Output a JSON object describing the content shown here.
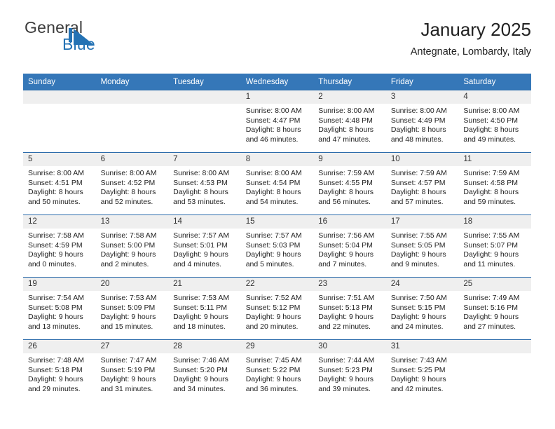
{
  "brand": {
    "name_part1": "General",
    "name_part2": "Blue",
    "mark": "triangle-flag-icon",
    "accent_color": "#2472b4"
  },
  "header": {
    "title": "January 2025",
    "location": "Antegnate, Lombardy, Italy"
  },
  "theme": {
    "header_bg": "#3577b8",
    "daynum_bg": "#efefef",
    "row_divider": "#2c6cab",
    "text": "#222222"
  },
  "weekday_headers": [
    "Sunday",
    "Monday",
    "Tuesday",
    "Wednesday",
    "Thursday",
    "Friday",
    "Saturday"
  ],
  "weeks": [
    [
      {
        "day": "",
        "lines": []
      },
      {
        "day": "",
        "lines": []
      },
      {
        "day": "",
        "lines": []
      },
      {
        "day": "1",
        "lines": [
          "Sunrise: 8:00 AM",
          "Sunset: 4:47 PM",
          "Daylight: 8 hours",
          "and 46 minutes."
        ]
      },
      {
        "day": "2",
        "lines": [
          "Sunrise: 8:00 AM",
          "Sunset: 4:48 PM",
          "Daylight: 8 hours",
          "and 47 minutes."
        ]
      },
      {
        "day": "3",
        "lines": [
          "Sunrise: 8:00 AM",
          "Sunset: 4:49 PM",
          "Daylight: 8 hours",
          "and 48 minutes."
        ]
      },
      {
        "day": "4",
        "lines": [
          "Sunrise: 8:00 AM",
          "Sunset: 4:50 PM",
          "Daylight: 8 hours",
          "and 49 minutes."
        ]
      }
    ],
    [
      {
        "day": "5",
        "lines": [
          "Sunrise: 8:00 AM",
          "Sunset: 4:51 PM",
          "Daylight: 8 hours",
          "and 50 minutes."
        ]
      },
      {
        "day": "6",
        "lines": [
          "Sunrise: 8:00 AM",
          "Sunset: 4:52 PM",
          "Daylight: 8 hours",
          "and 52 minutes."
        ]
      },
      {
        "day": "7",
        "lines": [
          "Sunrise: 8:00 AM",
          "Sunset: 4:53 PM",
          "Daylight: 8 hours",
          "and 53 minutes."
        ]
      },
      {
        "day": "8",
        "lines": [
          "Sunrise: 8:00 AM",
          "Sunset: 4:54 PM",
          "Daylight: 8 hours",
          "and 54 minutes."
        ]
      },
      {
        "day": "9",
        "lines": [
          "Sunrise: 7:59 AM",
          "Sunset: 4:55 PM",
          "Daylight: 8 hours",
          "and 56 minutes."
        ]
      },
      {
        "day": "10",
        "lines": [
          "Sunrise: 7:59 AM",
          "Sunset: 4:57 PM",
          "Daylight: 8 hours",
          "and 57 minutes."
        ]
      },
      {
        "day": "11",
        "lines": [
          "Sunrise: 7:59 AM",
          "Sunset: 4:58 PM",
          "Daylight: 8 hours",
          "and 59 minutes."
        ]
      }
    ],
    [
      {
        "day": "12",
        "lines": [
          "Sunrise: 7:58 AM",
          "Sunset: 4:59 PM",
          "Daylight: 9 hours",
          "and 0 minutes."
        ]
      },
      {
        "day": "13",
        "lines": [
          "Sunrise: 7:58 AM",
          "Sunset: 5:00 PM",
          "Daylight: 9 hours",
          "and 2 minutes."
        ]
      },
      {
        "day": "14",
        "lines": [
          "Sunrise: 7:57 AM",
          "Sunset: 5:01 PM",
          "Daylight: 9 hours",
          "and 4 minutes."
        ]
      },
      {
        "day": "15",
        "lines": [
          "Sunrise: 7:57 AM",
          "Sunset: 5:03 PM",
          "Daylight: 9 hours",
          "and 5 minutes."
        ]
      },
      {
        "day": "16",
        "lines": [
          "Sunrise: 7:56 AM",
          "Sunset: 5:04 PM",
          "Daylight: 9 hours",
          "and 7 minutes."
        ]
      },
      {
        "day": "17",
        "lines": [
          "Sunrise: 7:55 AM",
          "Sunset: 5:05 PM",
          "Daylight: 9 hours",
          "and 9 minutes."
        ]
      },
      {
        "day": "18",
        "lines": [
          "Sunrise: 7:55 AM",
          "Sunset: 5:07 PM",
          "Daylight: 9 hours",
          "and 11 minutes."
        ]
      }
    ],
    [
      {
        "day": "19",
        "lines": [
          "Sunrise: 7:54 AM",
          "Sunset: 5:08 PM",
          "Daylight: 9 hours",
          "and 13 minutes."
        ]
      },
      {
        "day": "20",
        "lines": [
          "Sunrise: 7:53 AM",
          "Sunset: 5:09 PM",
          "Daylight: 9 hours",
          "and 15 minutes."
        ]
      },
      {
        "day": "21",
        "lines": [
          "Sunrise: 7:53 AM",
          "Sunset: 5:11 PM",
          "Daylight: 9 hours",
          "and 18 minutes."
        ]
      },
      {
        "day": "22",
        "lines": [
          "Sunrise: 7:52 AM",
          "Sunset: 5:12 PM",
          "Daylight: 9 hours",
          "and 20 minutes."
        ]
      },
      {
        "day": "23",
        "lines": [
          "Sunrise: 7:51 AM",
          "Sunset: 5:13 PM",
          "Daylight: 9 hours",
          "and 22 minutes."
        ]
      },
      {
        "day": "24",
        "lines": [
          "Sunrise: 7:50 AM",
          "Sunset: 5:15 PM",
          "Daylight: 9 hours",
          "and 24 minutes."
        ]
      },
      {
        "day": "25",
        "lines": [
          "Sunrise: 7:49 AM",
          "Sunset: 5:16 PM",
          "Daylight: 9 hours",
          "and 27 minutes."
        ]
      }
    ],
    [
      {
        "day": "26",
        "lines": [
          "Sunrise: 7:48 AM",
          "Sunset: 5:18 PM",
          "Daylight: 9 hours",
          "and 29 minutes."
        ]
      },
      {
        "day": "27",
        "lines": [
          "Sunrise: 7:47 AM",
          "Sunset: 5:19 PM",
          "Daylight: 9 hours",
          "and 31 minutes."
        ]
      },
      {
        "day": "28",
        "lines": [
          "Sunrise: 7:46 AM",
          "Sunset: 5:20 PM",
          "Daylight: 9 hours",
          "and 34 minutes."
        ]
      },
      {
        "day": "29",
        "lines": [
          "Sunrise: 7:45 AM",
          "Sunset: 5:22 PM",
          "Daylight: 9 hours",
          "and 36 minutes."
        ]
      },
      {
        "day": "30",
        "lines": [
          "Sunrise: 7:44 AM",
          "Sunset: 5:23 PM",
          "Daylight: 9 hours",
          "and 39 minutes."
        ]
      },
      {
        "day": "31",
        "lines": [
          "Sunrise: 7:43 AM",
          "Sunset: 5:25 PM",
          "Daylight: 9 hours",
          "and 42 minutes."
        ]
      },
      {
        "day": "",
        "lines": []
      }
    ]
  ]
}
